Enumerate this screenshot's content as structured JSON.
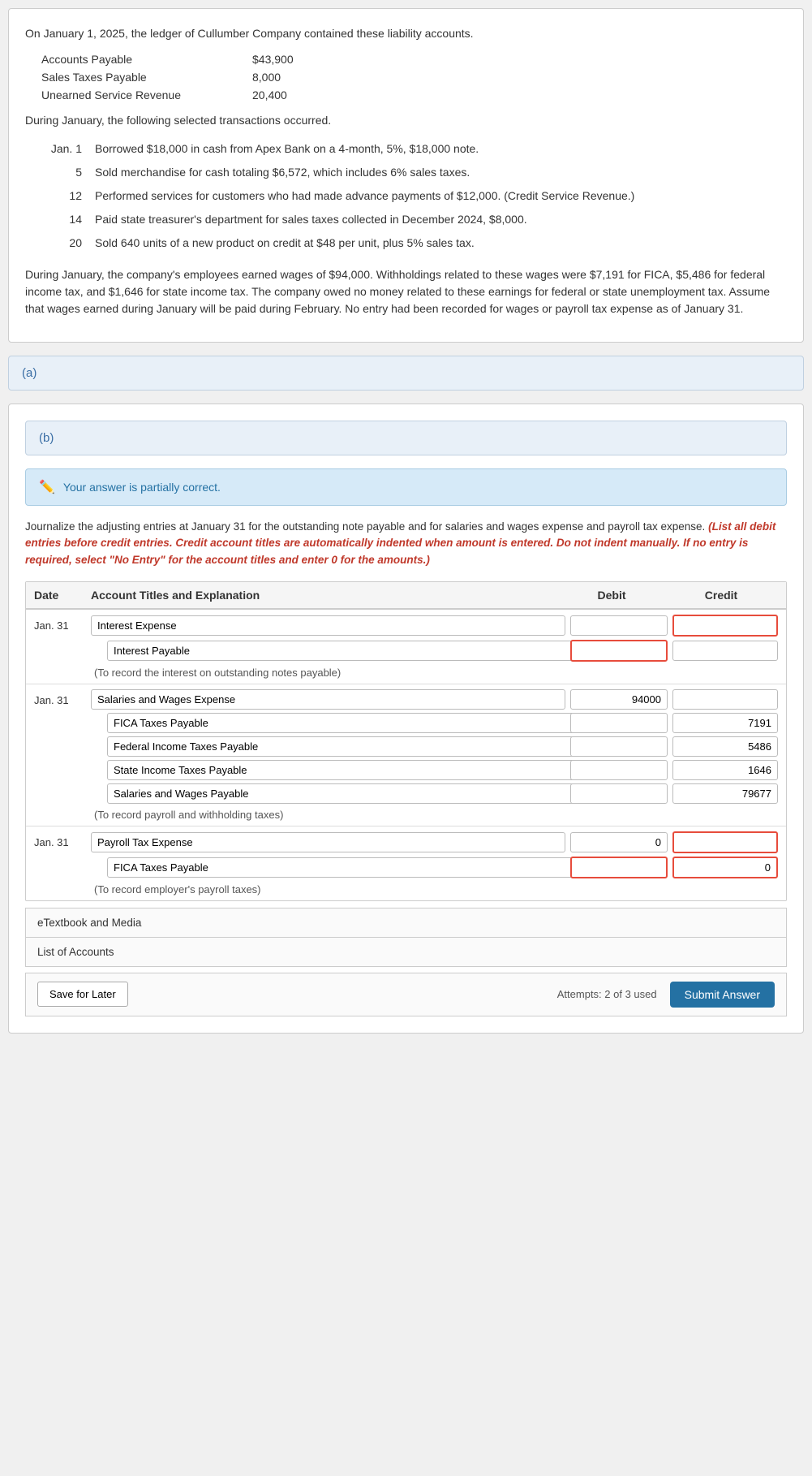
{
  "problem": {
    "intro": "On January 1, 2025, the ledger of Cullumber Company contained these liability accounts.",
    "liabilities": [
      {
        "name": "Accounts Payable",
        "amount": "$43,900"
      },
      {
        "name": "Sales Taxes Payable",
        "amount": "8,000"
      },
      {
        "name": "Unearned Service Revenue",
        "amount": "20,400"
      }
    ],
    "transactions_intro": "During January, the following selected transactions occurred.",
    "transactions": [
      {
        "date": "Jan. 1",
        "desc": "Borrowed $18,000 in cash from Apex Bank on a 4-month, 5%, $18,000 note."
      },
      {
        "date": "5",
        "desc": "Sold merchandise for cash totaling $6,572, which includes 6% sales taxes."
      },
      {
        "date": "12",
        "desc": "Performed services for customers who had made advance payments of $12,000. (Credit Service Revenue.)"
      },
      {
        "date": "14",
        "desc": "Paid state treasurer's department for sales taxes collected in December 2024, $8,000."
      },
      {
        "date": "20",
        "desc": "Sold 640 units of a new product on credit at $48 per unit, plus 5% sales tax."
      }
    ],
    "payroll_para": "During January, the company's employees earned wages of $94,000. Withholdings related to these wages were $7,191 for FICA, $5,486 for federal income tax, and $1,646 for state income tax. The company owed no money related to these earnings for federal or state unemployment tax. Assume that wages earned during January will be paid during February. No entry had been recorded for wages or payroll tax expense as of January 31."
  },
  "section_a": {
    "label": "(a)"
  },
  "section_b": {
    "label": "(b)",
    "banner": "Your answer is partially correct.",
    "instructions_plain": "Journalize the adjusting entries at January 31 for the outstanding note payable and for salaries and wages expense and payroll tax expense.",
    "instructions_red": "(List all debit entries before credit entries. Credit account titles are automatically indented when amount is entered. Do not indent manually. If no entry is required, select \"No Entry\" for the account titles and enter 0 for the amounts.)",
    "table_headers": {
      "date": "Date",
      "account": "Account Titles and Explanation",
      "debit": "Debit",
      "credit": "Credit"
    },
    "entries": [
      {
        "date": "Jan. 31",
        "lines": [
          {
            "account": "Interest Expense",
            "debit": "",
            "credit": "",
            "debit_red": false,
            "credit_red": true,
            "indent": false
          },
          {
            "account": "Interest Payable",
            "debit": "",
            "credit": "",
            "debit_red": true,
            "credit_red": false,
            "indent": true
          }
        ],
        "note": "(To record the interest on outstanding notes payable)"
      },
      {
        "date": "Jan. 31",
        "lines": [
          {
            "account": "Salaries and Wages Expense",
            "debit": "94000",
            "credit": "",
            "debit_red": false,
            "credit_red": false,
            "indent": false
          },
          {
            "account": "FICA Taxes Payable",
            "debit": "",
            "credit": "7191",
            "debit_red": false,
            "credit_red": false,
            "indent": true
          },
          {
            "account": "Federal Income Taxes Payable",
            "debit": "",
            "credit": "5486",
            "debit_red": false,
            "credit_red": false,
            "indent": true
          },
          {
            "account": "State Income Taxes Payable",
            "debit": "",
            "credit": "1646",
            "debit_red": false,
            "credit_red": false,
            "indent": true
          },
          {
            "account": "Salaries and Wages Payable",
            "debit": "",
            "credit": "79677",
            "debit_red": false,
            "credit_red": false,
            "indent": true
          }
        ],
        "note": "(To record payroll and withholding taxes)"
      },
      {
        "date": "Jan. 31",
        "lines": [
          {
            "account": "Payroll Tax Expense",
            "debit": "0",
            "credit": "",
            "debit_red": false,
            "credit_red": true,
            "indent": false
          },
          {
            "account": "FICA Taxes Payable",
            "debit": "",
            "credit": "0",
            "debit_red": true,
            "credit_red": true,
            "indent": true
          }
        ],
        "note": "(To record employer's payroll taxes)"
      }
    ],
    "etextbook": "eTextbook and Media",
    "list_of_accounts": "List of Accounts",
    "save_label": "Save for Later",
    "attempts_text": "Attempts: 2 of 3 used",
    "submit_label": "Submit Answer"
  }
}
